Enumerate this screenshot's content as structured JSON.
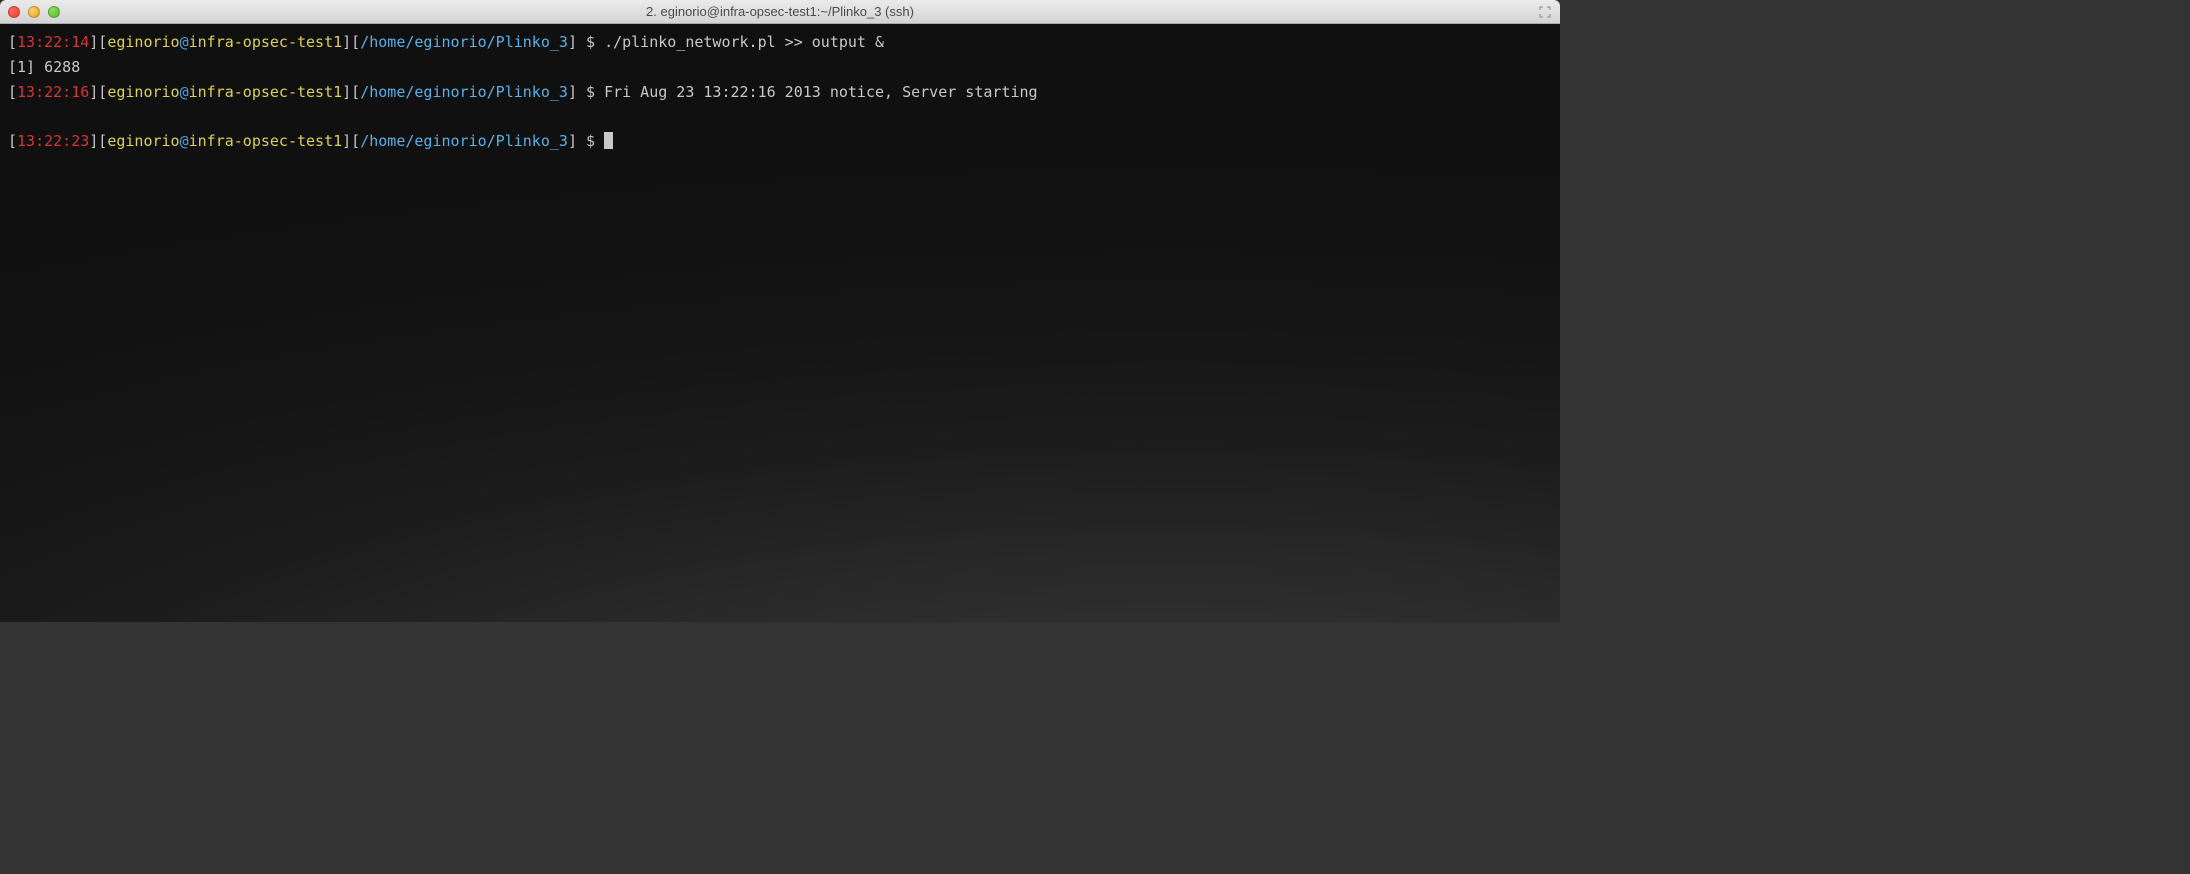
{
  "window": {
    "title": "2. eginorio@infra-opsec-test1:~/Plinko_3 (ssh)"
  },
  "lines": [
    {
      "time": "13:22:14",
      "user": "eginorio",
      "host": "infra-opsec-test1",
      "path": "/home/eginorio/Plinko_3",
      "command": "./plinko_network.pl >> output &"
    },
    {
      "output": "[1] 6288"
    },
    {
      "time": "13:22:16",
      "user": "eginorio",
      "host": "infra-opsec-test1",
      "path": "/home/eginorio/Plinko_3",
      "command": "Fri Aug 23 13:22:16 2013 notice, Server starting"
    },
    {
      "blank": true
    },
    {
      "time": "13:22:23",
      "user": "eginorio",
      "host": "infra-opsec-test1",
      "path": "/home/eginorio/Plinko_3",
      "command": "",
      "cursor": true
    }
  ]
}
